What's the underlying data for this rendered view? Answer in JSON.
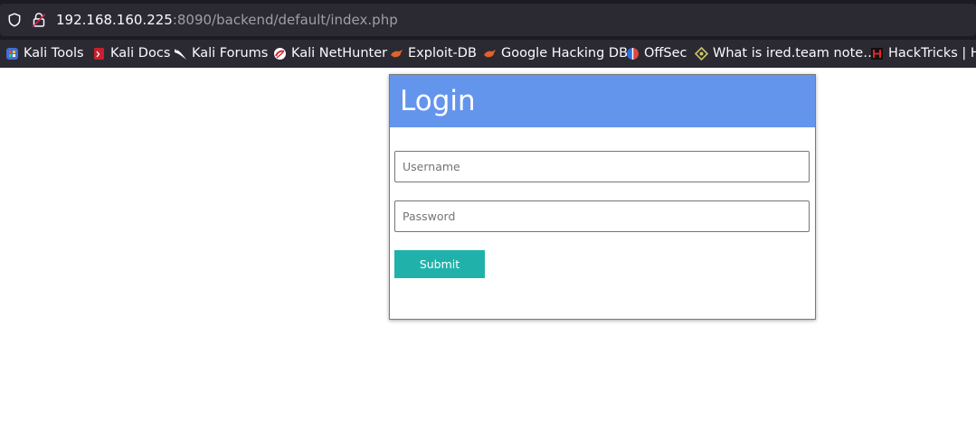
{
  "browser": {
    "url_host": "192.168.160.225",
    "url_rest": ":8090/backend/default/index.php",
    "bookmarks": [
      {
        "label": "Kali Tools",
        "icon": "kali-tools-icon"
      },
      {
        "label": "Kali Docs",
        "icon": "kali-docs-icon"
      },
      {
        "label": "Kali Forums",
        "icon": "kali-forums-icon"
      },
      {
        "label": "Kali NetHunter",
        "icon": "kali-nethunter-icon"
      },
      {
        "label": "Exploit-DB",
        "icon": "exploit-db-icon"
      },
      {
        "label": "Google Hacking DB",
        "icon": "google-hacking-db-icon"
      },
      {
        "label": "OffSec",
        "icon": "offsec-icon"
      },
      {
        "label": "What is ired.team note…",
        "icon": "ired-team-icon"
      },
      {
        "label": "HackTricks | Ha",
        "icon": "hacktricks-icon"
      }
    ]
  },
  "login": {
    "title": "Login",
    "username_placeholder": "Username",
    "password_placeholder": "Password",
    "submit_label": "Submit"
  },
  "colors": {
    "header": "#6495ed",
    "submit": "#20b2aa",
    "chrome_dark": "#2b2a33"
  }
}
